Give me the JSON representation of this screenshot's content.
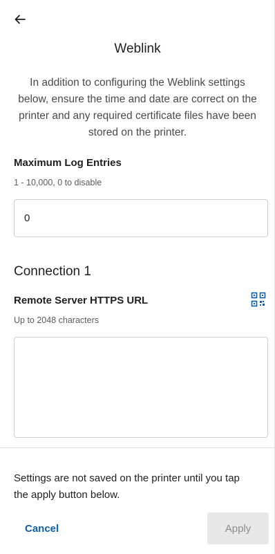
{
  "header": {
    "back_icon": "arrow-left-icon",
    "title": "Weblink"
  },
  "intro": {
    "text": "In addition to configuring the Weblink settings below, ensure the time and date are correct on the printer and any required certificate files have been stored on the printer."
  },
  "log_entries": {
    "label": "Maximum Log Entries",
    "helper": "1 - 10,000, 0 to disable",
    "value": "0"
  },
  "connection": {
    "title": "Connection 1",
    "url_label": "Remote Server HTTPS URL",
    "url_helper": "Up to 2048 characters",
    "url_value": "",
    "scan_icon": "qr-scan-icon"
  },
  "footer": {
    "note": "Settings are not saved on the printer until you tap the apply button below.",
    "cancel_label": "Cancel",
    "apply_label": "Apply"
  },
  "colors": {
    "accent": "#0b5fae",
    "disabled_bg": "#e8e8e8",
    "disabled_text": "#8c8c8c"
  }
}
